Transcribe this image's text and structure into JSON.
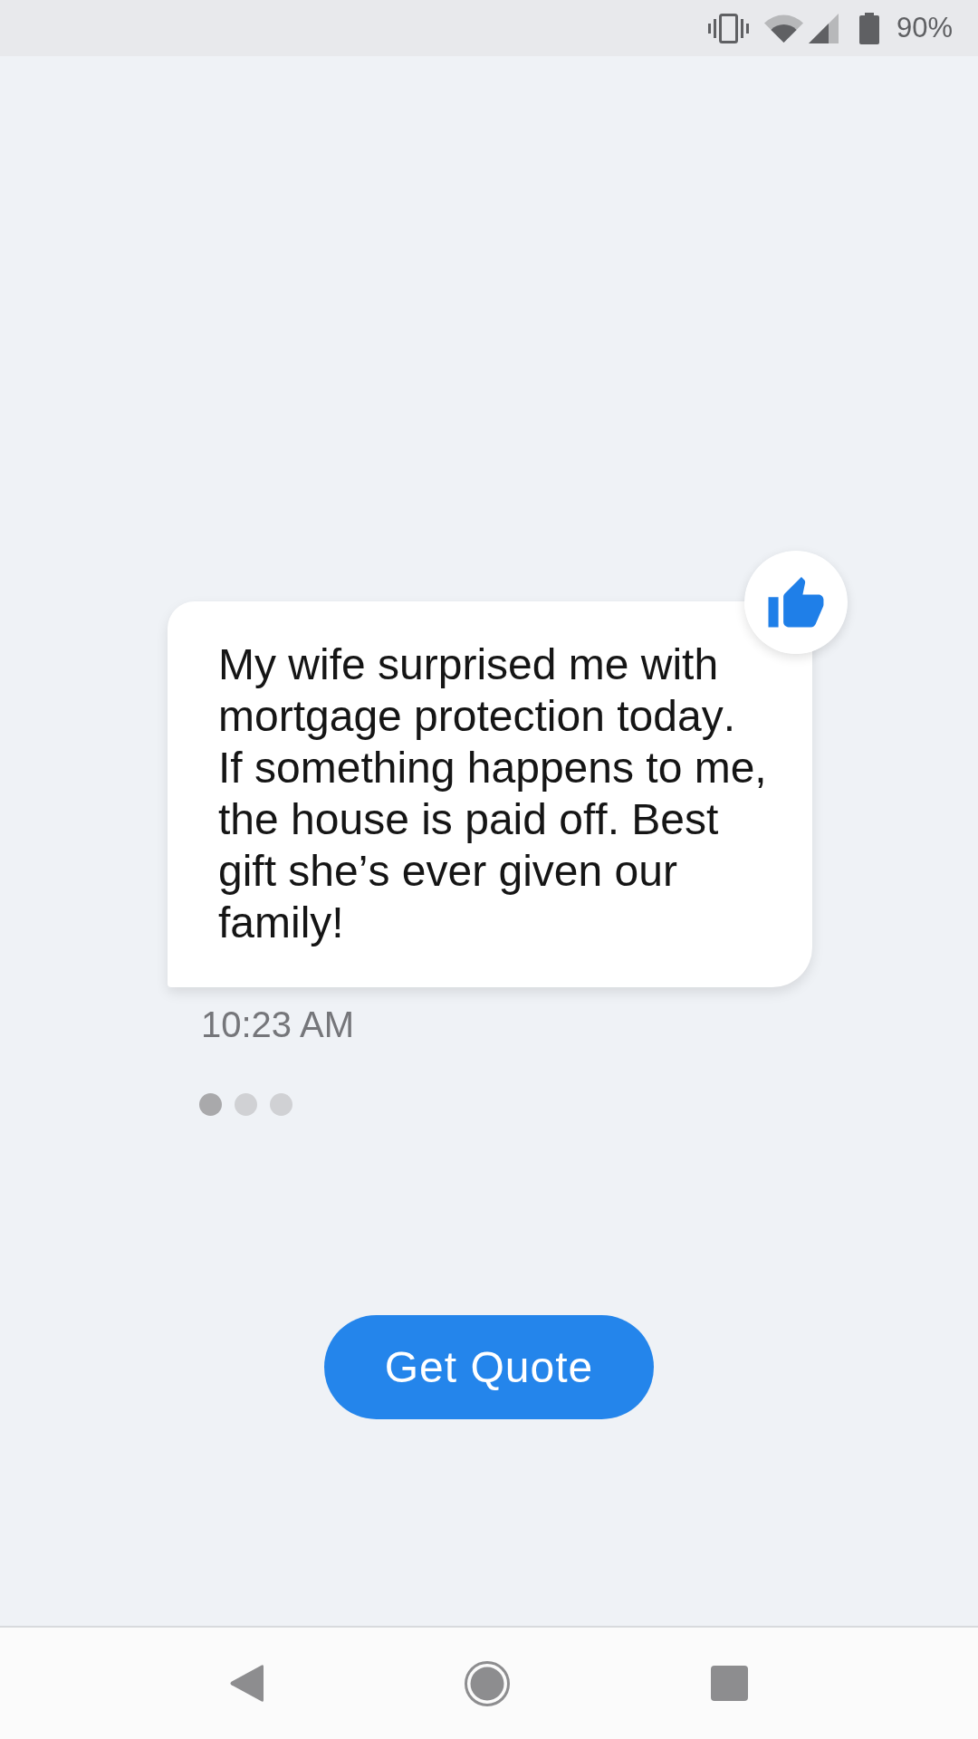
{
  "status_bar": {
    "battery_percent": "90%"
  },
  "message": {
    "text": "My wife surprised me with mortgage protection today. If something happens to me, the house is paid off. Best gift she’s ever given our family!",
    "liked": true,
    "time": "10:23 AM"
  },
  "typing_indicator": [
    {
      "active": true
    },
    {
      "active": false
    },
    {
      "active": false
    }
  ],
  "action_button": {
    "label": "Get Quote"
  }
}
